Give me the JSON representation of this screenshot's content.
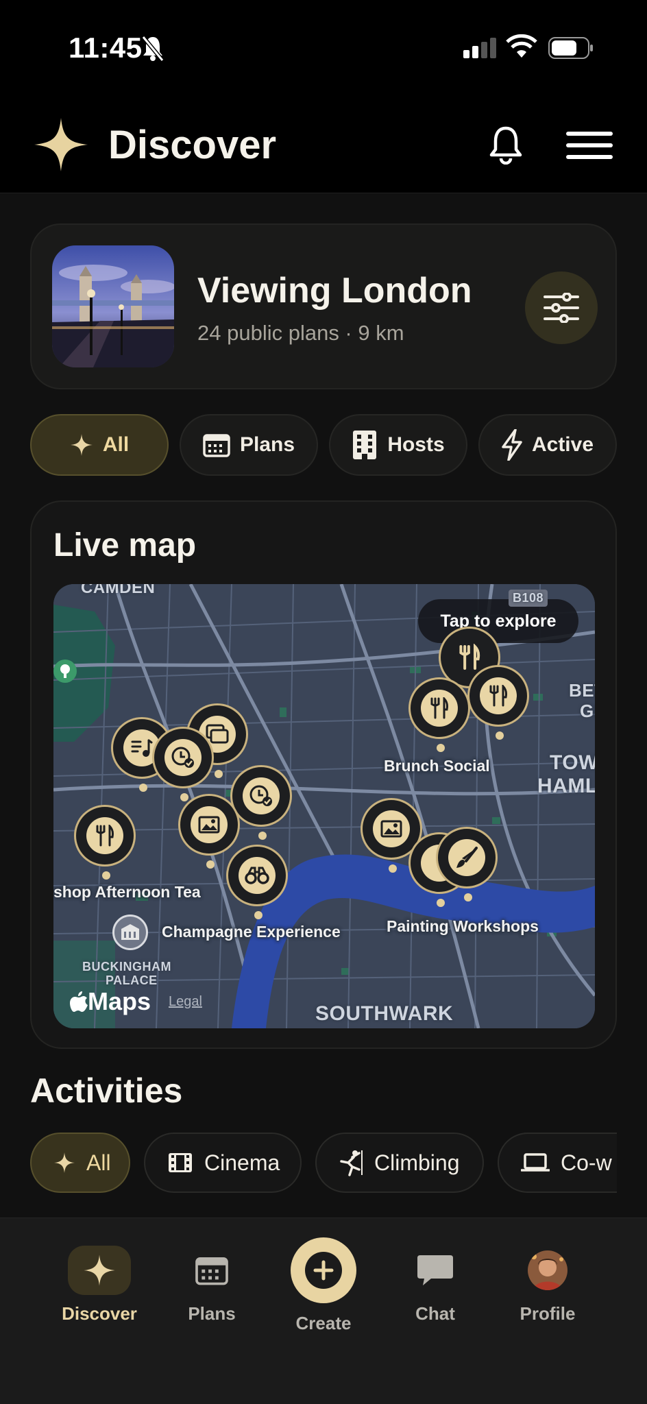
{
  "status_bar": {
    "time": "11:45"
  },
  "header": {
    "title": "Discover"
  },
  "location": {
    "title": "Viewing London",
    "meta": "24 public plans · 9 km"
  },
  "filter_chips": [
    {
      "label": "All",
      "icon": "sparkle-icon",
      "active": true
    },
    {
      "label": "Plans",
      "icon": "calendar-icon",
      "active": false
    },
    {
      "label": "Hosts",
      "icon": "building-icon",
      "active": false
    },
    {
      "label": "Active",
      "icon": "bolt-icon",
      "active": false
    }
  ],
  "live_map": {
    "title": "Live map",
    "cta": "Tap to explore",
    "labels": {
      "brunch": "Brunch Social",
      "afternoon_tea": "shop Afternoon Tea",
      "champagne": "Champagne Experience",
      "painting": "Painting Workshops"
    },
    "areas": {
      "camden": "CAMDEN",
      "buckingham": "BUCKINGHAM",
      "palace": "PALACE",
      "southwark": "SOUTHWARK",
      "tower": "TOW",
      "hamlets": "HAML",
      "bethnal1": "BET",
      "bethnal2": "GI",
      "road": "B108"
    },
    "attribution": {
      "maps": "Maps",
      "legal": "Legal"
    }
  },
  "activities": {
    "title": "Activities",
    "chips": [
      {
        "label": "All",
        "icon": "sparkle-icon",
        "active": true
      },
      {
        "label": "Cinema",
        "icon": "film-icon",
        "active": false
      },
      {
        "label": "Climbing",
        "icon": "climber-icon",
        "active": false
      },
      {
        "label": "Co-w",
        "icon": "laptop-icon",
        "active": false
      }
    ]
  },
  "tabbar": {
    "discover": "Discover",
    "plans": "Plans",
    "create": "Create",
    "chat": "Chat",
    "profile": "Profile"
  },
  "colors": {
    "accent": "#E9D6A6",
    "background": "#111111",
    "map_river": "#2B47A8"
  }
}
